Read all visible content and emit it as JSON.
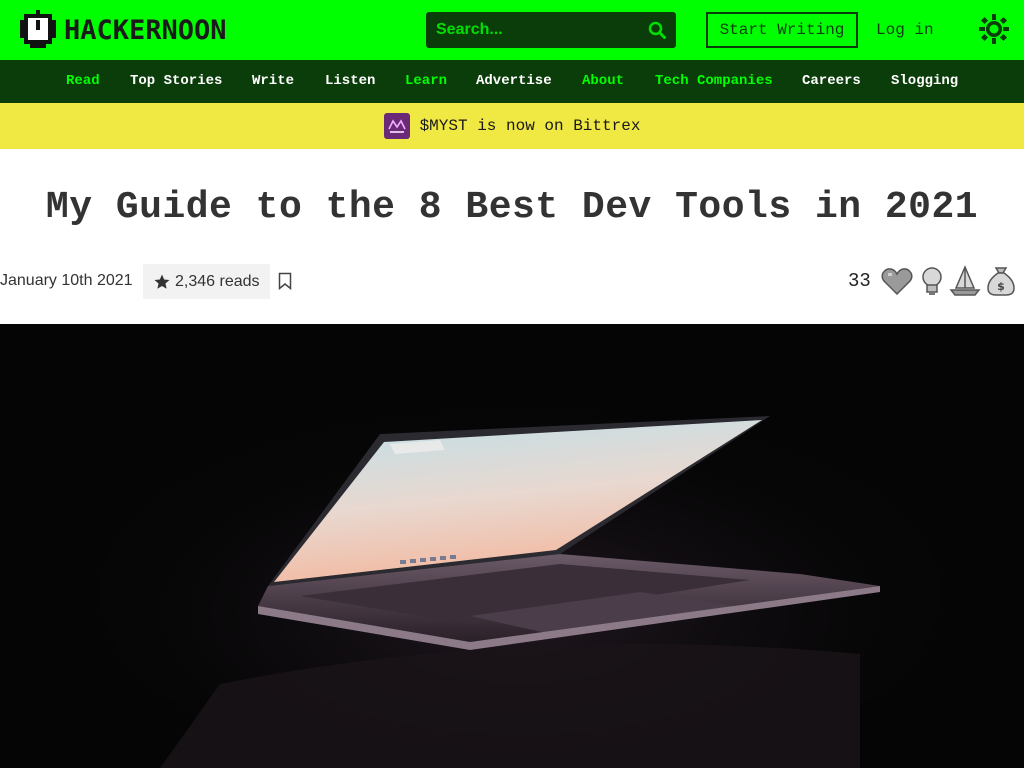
{
  "header": {
    "logo_text": "HACKERNOON",
    "search_placeholder": "Search...",
    "start_writing_label": "Start Writing",
    "login_label": "Log in"
  },
  "nav": {
    "items": [
      {
        "label": "Read",
        "highlight": true
      },
      {
        "label": "Top Stories",
        "highlight": false
      },
      {
        "label": "Write",
        "highlight": false
      },
      {
        "label": "Listen",
        "highlight": false
      },
      {
        "label": "Learn",
        "highlight": true
      },
      {
        "label": "Advertise",
        "highlight": false
      },
      {
        "label": "About",
        "highlight": true
      },
      {
        "label": "Tech Companies",
        "highlight": true
      },
      {
        "label": "Careers",
        "highlight": false
      },
      {
        "label": "Slogging",
        "highlight": false
      }
    ]
  },
  "banner": {
    "text": "$MYST is now on Bittrex"
  },
  "article": {
    "title": "My Guide to the 8 Best Dev Tools in 2021",
    "date": "January 10th 2021",
    "reads": "2,346 reads",
    "reaction_count": "33",
    "reactions": [
      "heart-icon",
      "lightbulb-icon",
      "boat-icon",
      "money-bag-icon"
    ]
  },
  "colors": {
    "brand_green": "#00ff00",
    "dark_green": "#0b3d0b",
    "banner_yellow": "#f0e843"
  }
}
